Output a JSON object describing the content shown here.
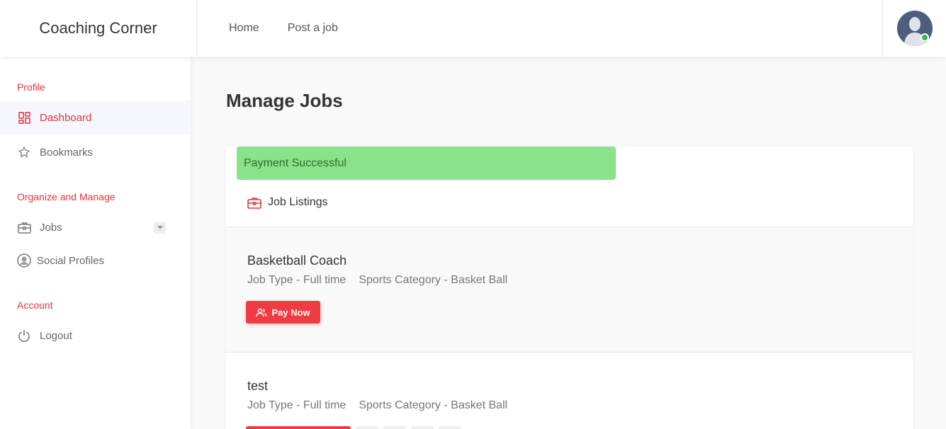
{
  "header": {
    "brand": "Coaching Corner",
    "nav": [
      {
        "label": "Home"
      },
      {
        "label": "Post a job"
      }
    ],
    "user": {
      "status": "online",
      "status_color": "#38b653"
    }
  },
  "sidebar": {
    "sections": [
      {
        "heading": "Profile",
        "items": [
          {
            "label": "Dashboard",
            "icon": "dashboard-icon",
            "active": true
          },
          {
            "label": "Bookmarks",
            "icon": "star-icon"
          }
        ]
      },
      {
        "heading": "Organize and Manage",
        "items": [
          {
            "label": "Jobs",
            "icon": "briefcase-icon",
            "has_dropdown": true
          },
          {
            "label": "Social Profiles",
            "icon": "user-circle-icon"
          }
        ]
      },
      {
        "heading": "Account",
        "items": [
          {
            "label": "Logout",
            "icon": "power-icon"
          }
        ]
      }
    ]
  },
  "main": {
    "title": "Manage Jobs",
    "alert": "Payment Successful",
    "listings_title": "Job Listings",
    "jobs": [
      {
        "title": "Basketball Coach",
        "job_type": "Job Type - Full time",
        "category": "Sports Category - Basket Ball",
        "action": "Pay Now"
      },
      {
        "title": "test",
        "job_type": "Job Type - Full time",
        "category": "Sports Category - Basket Ball"
      }
    ]
  },
  "colors": {
    "accent": "#e0353b",
    "button": "#ef3c42",
    "alert_bg": "#8ae28a",
    "alert_text": "#2e6b2e"
  }
}
